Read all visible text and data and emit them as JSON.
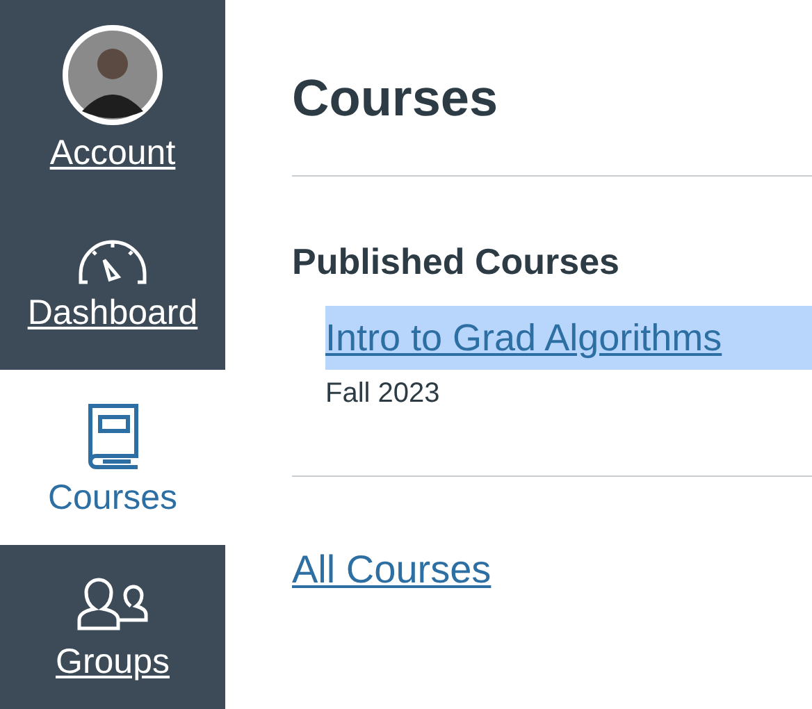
{
  "nav": [
    {
      "kind": "avatar",
      "label": "Account",
      "selected": false
    },
    {
      "kind": "dashboard",
      "label": "Dashboard",
      "selected": false
    },
    {
      "kind": "courses",
      "label": "Courses",
      "selected": true
    },
    {
      "kind": "groups",
      "label": "Groups",
      "selected": false
    }
  ],
  "heading": "Courses",
  "section_title": "Published Courses",
  "courses": [
    {
      "name": "Intro to Grad Algorithms",
      "term": "Fall 2023",
      "highlighted": true
    }
  ],
  "all_courses_link": "All Courses"
}
